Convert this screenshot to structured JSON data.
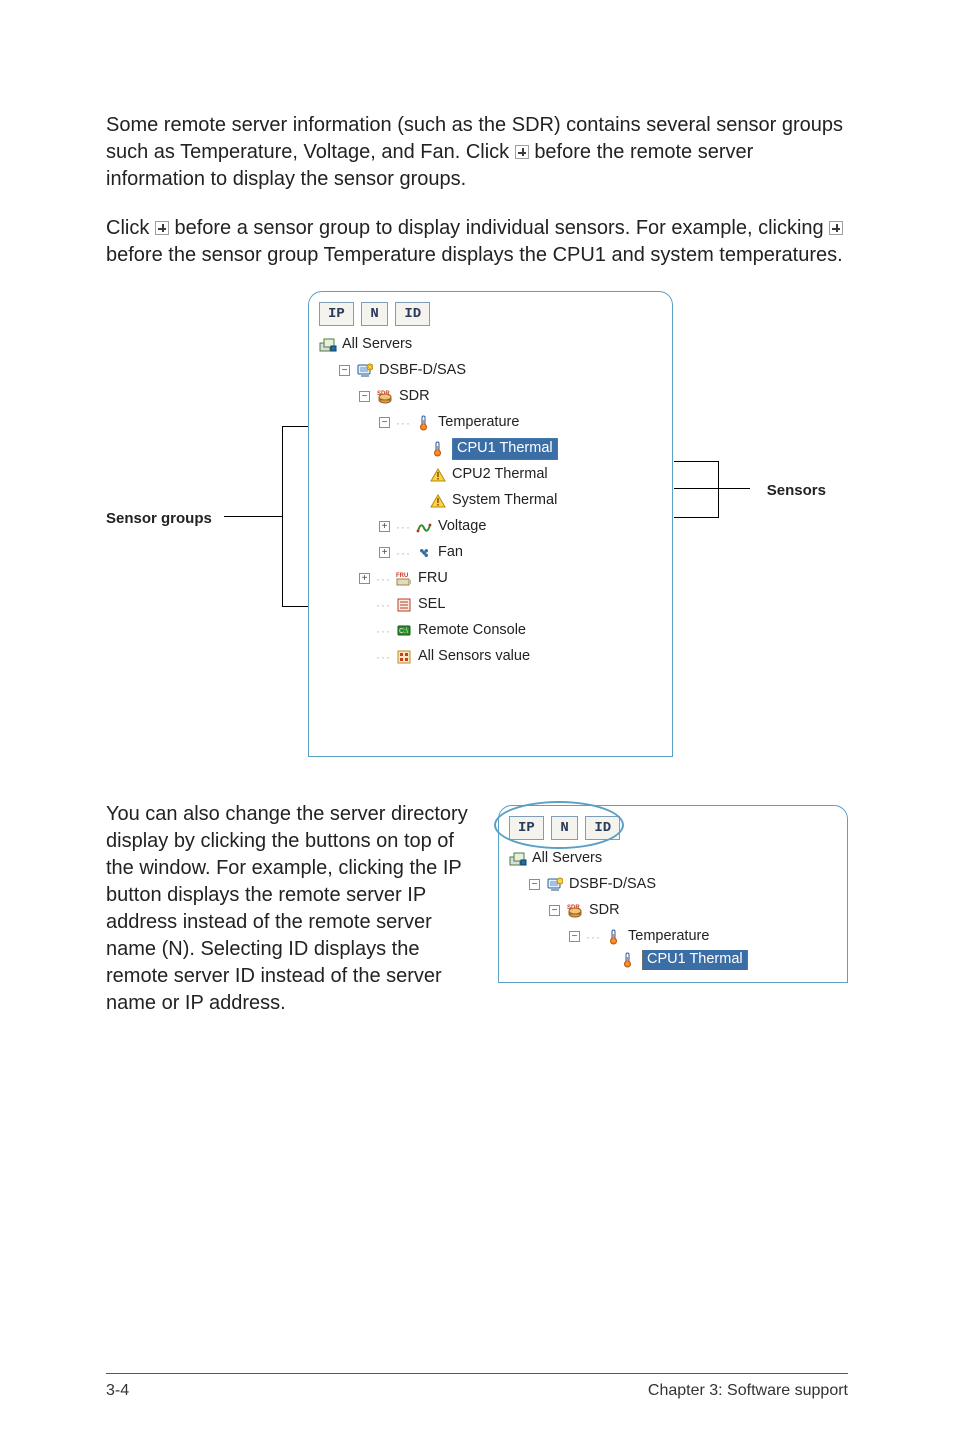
{
  "para1_a": "Some remote server information (such as the SDR) contains several sensor groups such as Temperature, Voltage, and Fan. Click ",
  "para1_b": " before the remote server information to display the sensor groups.",
  "para2_a": "Click ",
  "para2_b": " before a sensor group to display individual sensors. For example, clicking ",
  "para2_c": " before the sensor group Temperature displays the CPU1 and system temperatures.",
  "labels": {
    "sensor_groups": "Sensor groups",
    "sensors": "Sensors"
  },
  "tabs": {
    "ip": "IP",
    "n": "N",
    "id": "ID"
  },
  "tree": {
    "root": "All Servers",
    "server": "DSBF-D/SAS",
    "sdr": "SDR",
    "sdr_badge": "SDR",
    "temperature": "Temperature",
    "cpu1": "CPU1 Thermal",
    "cpu2": "CPU2 Thermal",
    "system": "System Thermal",
    "voltage": "Voltage",
    "fan": "Fan",
    "fru": "FRU",
    "fru_badge": "FRU",
    "sel": "SEL",
    "remote_console": "Remote Console",
    "all_sensors": "All Sensors value"
  },
  "bottom_para": "You can also change the server directory display by clicking the buttons on top of the window. For example, clicking the IP button displays the remote server IP address instead of the remote server name (N). Selecting ID displays the remote server ID instead of the server name or IP address.",
  "fig2": {
    "cpu1_trunc": "CPU1 Thermal"
  },
  "footer": {
    "page": "3-4",
    "chapter": "Chapter 3: Software support"
  }
}
